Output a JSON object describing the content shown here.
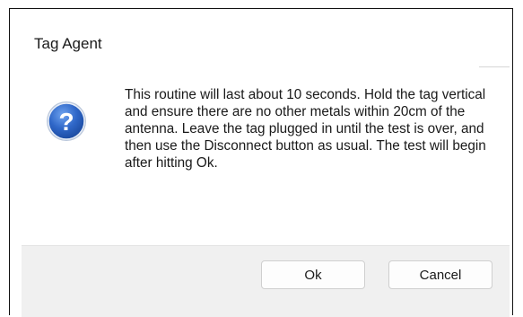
{
  "window": {
    "title": "Tag Agent"
  },
  "dialog": {
    "icon": "question-icon",
    "message": "This routine will last about 10 seconds. Hold the tag vertical and ensure there are no other metals within 20cm of the antenna. Leave the tag plugged in until the test is over, and then use the Disconnect button as usual. The test will begin after hitting Ok."
  },
  "buttons": {
    "ok_label": "Ok",
    "cancel_label": "Cancel"
  },
  "colors": {
    "icon_blue": "#2f67c8",
    "footer_bg": "#f0f0f0"
  }
}
